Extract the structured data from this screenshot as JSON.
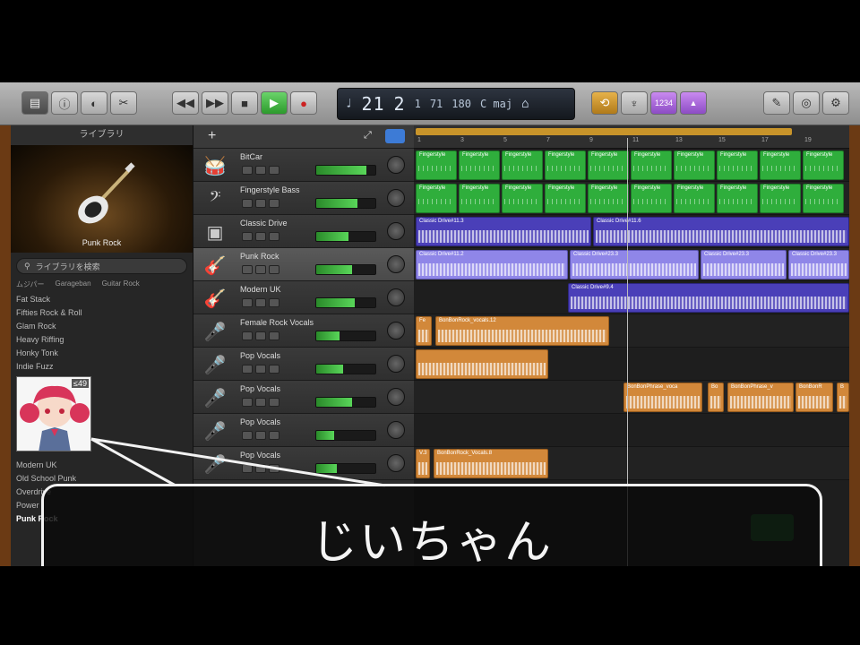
{
  "toolbar": {
    "left_icons": [
      "library-icon",
      "info-icon",
      "smart-controls-icon",
      "scissors-icon"
    ],
    "transport_icons": [
      "rewind-icon",
      "forward-icon",
      "stop-icon",
      "play-icon",
      "record-icon"
    ],
    "lcd": {
      "bar": "21",
      "beat": "2",
      "div": "1",
      "tick": "71",
      "tempo": "180",
      "key": "C maj",
      "signature_icon": "metronome-icon"
    },
    "right_icons": [
      "cycle-icon",
      "tuner-icon",
      "count-in-icon",
      "metronome-icon"
    ],
    "far_right_icons": [
      "notepad-icon",
      "loop-browser-icon",
      "media-browser-icon"
    ],
    "count_in": "1234"
  },
  "library": {
    "header": "ライブラリ",
    "art_caption": "Punk Rock",
    "search_placeholder": "ライブラリを検索",
    "breadcrumb": [
      "ムジパー",
      "Garageban",
      "Guitar Rock"
    ],
    "items": [
      "Fat Stack",
      "Fifties Rock & Roll",
      "Glam Rock",
      "Heavy Riffing",
      "Honky Tonk",
      "Indie Fuzz"
    ],
    "items_lower": [
      "Modern UK",
      "Old School Punk",
      "Overdrive",
      "Power",
      "Punk Rock"
    ],
    "avatar_badge": "≤49"
  },
  "tracks": [
    {
      "name": "BitCar",
      "icon": "drum-icon",
      "meter": 0.85
    },
    {
      "name": "Fingerstyle Bass",
      "icon": "bass-icon",
      "meter": 0.7
    },
    {
      "name": "Classic Drive",
      "icon": "amp-icon",
      "meter": 0.55
    },
    {
      "name": "Punk Rock",
      "icon": "guitar-icon",
      "meter": 0.6,
      "selected": true
    },
    {
      "name": "Modern UK",
      "icon": "guitar-red-icon",
      "meter": 0.65
    },
    {
      "name": "Female Rock Vocals",
      "icon": "mic-icon",
      "meter": 0.4
    },
    {
      "name": "Pop Vocals",
      "icon": "mic-icon",
      "meter": 0.45
    },
    {
      "name": "Pop Vocals",
      "icon": "mic-icon",
      "meter": 0.6
    },
    {
      "name": "Pop Vocals",
      "icon": "mic-icon",
      "meter": 0.3
    },
    {
      "name": "Pop Vocals",
      "icon": "mic-icon",
      "meter": 0.35
    }
  ],
  "regions": {
    "green_label": "Fingerstyle",
    "classic_drive": [
      "Classic Drive#11.3",
      "Classic Drive#11.6"
    ],
    "punk_rock": [
      "Classic Drive#11.2",
      "Classic Drive#23.3",
      "Classic Drive#23.3",
      "Classic Drive#23.3"
    ],
    "modern_uk": "Classic Drive#9.4",
    "female_vocals": [
      "Fe",
      "BonBonRock_vocals.12"
    ],
    "pop_vocals_2": [
      "BonBonPhrase_voca",
      "Bo",
      "BonBonPhrase_v",
      "BonBonR",
      "B"
    ],
    "pop_vocals_4": [
      "V.3",
      "BonBonRock_Vocals.8"
    ]
  },
  "ruler_marks": [
    "1",
    "3",
    "5",
    "7",
    "9",
    "11",
    "13",
    "15",
    "17",
    "19"
  ],
  "subtitle": "じいちゃん",
  "colors": {
    "green": "#2fae3c",
    "purple": "#4a3fb8",
    "lavender": "#8f86e8",
    "orange": "#d2883a"
  }
}
